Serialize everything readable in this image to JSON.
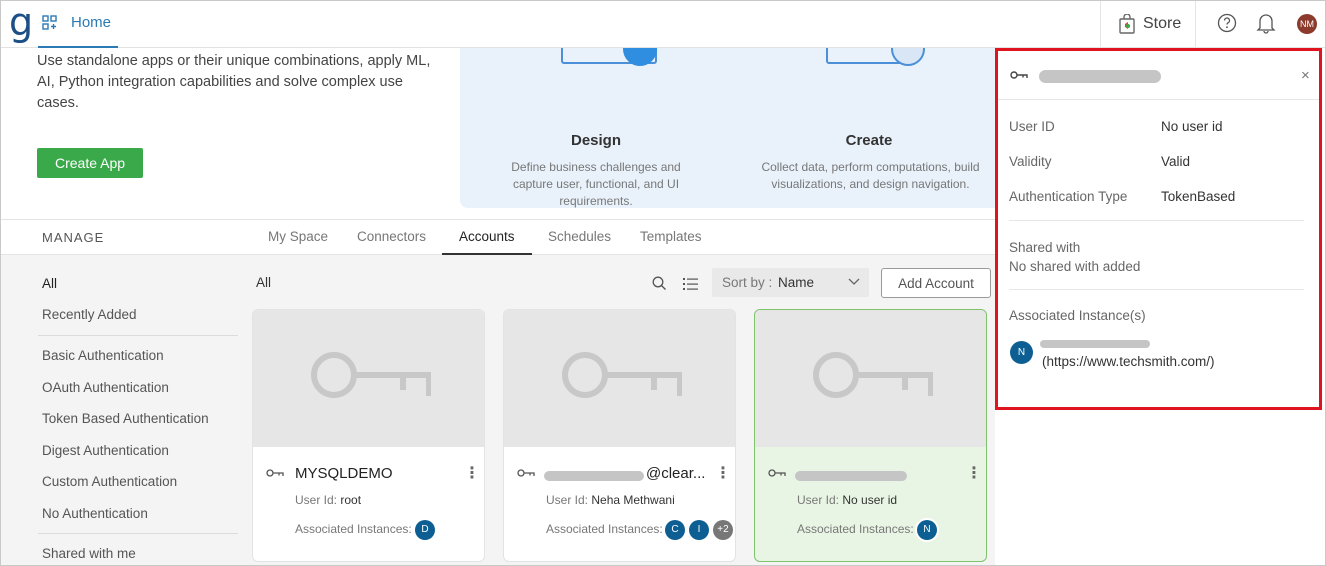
{
  "nav": {
    "logo": "g",
    "home_label": "Home",
    "store_label": "Store",
    "user_initials": "NM"
  },
  "hero": {
    "description": "Use standalone apps or their unique combinations, apply ML, AI, Python integration capabilities and solve complex use cases.",
    "create_app_label": "Create App",
    "steps": [
      {
        "title": "Design",
        "description": "Define business challenges and capture user, functional, and UI requirements."
      },
      {
        "title": "Create",
        "description": "Collect data, perform computations, build visualizations, and design navigation."
      }
    ]
  },
  "manage": {
    "label": "MANAGE",
    "tabs": [
      "My Space",
      "Connectors",
      "Accounts",
      "Schedules",
      "Templates"
    ],
    "active_tab": "Accounts"
  },
  "sidebar": {
    "items": [
      "All",
      "Recently Added",
      "Basic Authentication",
      "OAuth Authentication",
      "Token Based Authentication",
      "Digest Authentication",
      "Custom Authentication",
      "No Authentication",
      "Shared with me"
    ]
  },
  "toolbar": {
    "filter_label": "All",
    "sort_prefix": "Sort by :",
    "sort_value": "Name",
    "add_account_label": "Add Account"
  },
  "cards": [
    {
      "name": "MYSQLDEMO",
      "user_id_label": "User Id:",
      "user_id": "root",
      "assoc_label": "Associated Instances:",
      "instances": [
        "D"
      ]
    },
    {
      "name": "@clear...",
      "user_id_label": "User Id:",
      "user_id": "Neha Methwani",
      "assoc_label": "Associated Instances:",
      "instances": [
        "C",
        "I",
        "+2"
      ]
    },
    {
      "name": "",
      "user_id_label": "User Id:",
      "user_id": "No user id",
      "assoc_label": "Associated Instances:",
      "instances": [
        "N"
      ]
    }
  ],
  "panel": {
    "fields": [
      {
        "label": "User ID",
        "value": "No user id"
      },
      {
        "label": "Validity",
        "value": "Valid"
      },
      {
        "label": "Authentication Type",
        "value": "TokenBased"
      }
    ],
    "shared_title": "Shared with",
    "shared_value": "No shared with added",
    "instances_title": "Associated Instance(s)",
    "instance_initial": "N",
    "instance_url": "(https://www.techsmith.com/)",
    "close_glyph": "×"
  },
  "colors": {
    "accent": "#2a7ab5",
    "create_button": "#39a94a",
    "selected_card": "#e9f5e4",
    "highlight_border": "#e0141e",
    "badge": "#0d5f93"
  }
}
